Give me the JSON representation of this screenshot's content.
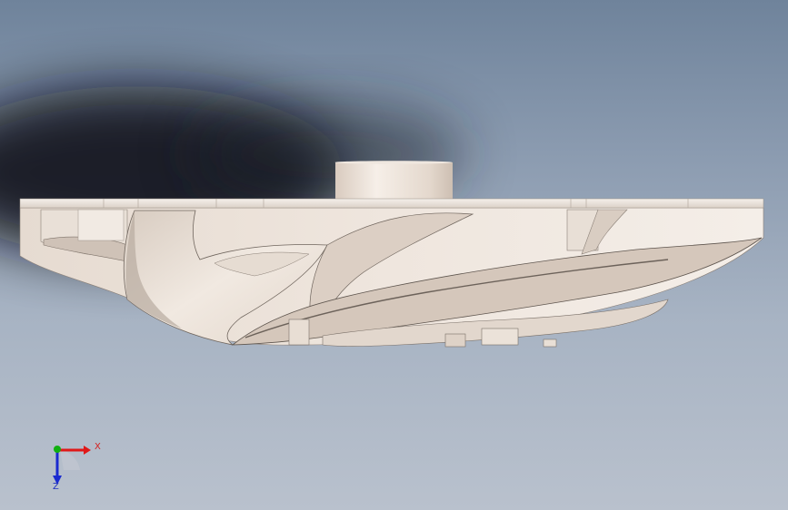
{
  "triad": {
    "x_label": "X",
    "z_label": "Z",
    "colors": {
      "x": "#e01818",
      "y": "#10b010",
      "z": "#1a2ad0"
    }
  },
  "scene": {
    "background_top": "#6f839b",
    "background_bottom": "#b9c1cd",
    "part_color": "#ece3db",
    "icons": [
      "impeller-model",
      "view-triad-icon"
    ]
  }
}
